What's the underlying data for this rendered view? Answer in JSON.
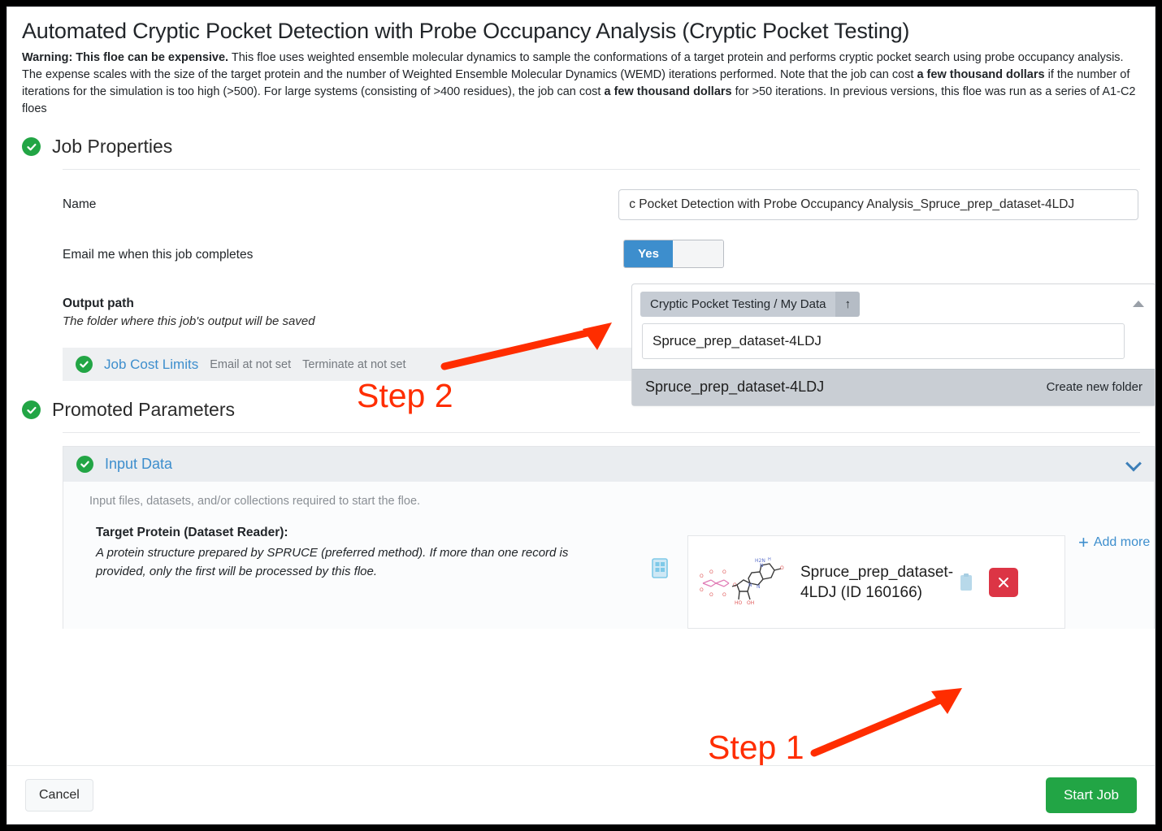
{
  "header": {
    "title": "Automated Cryptic Pocket Detection with Probe Occupancy Analysis (Cryptic Pocket Testing)",
    "warning_bold": "Warning: This floe can be expensive.",
    "desc_1": " This floe uses weighted ensemble molecular dynamics to sample the conformations of a target protein and performs cryptic pocket search using probe occupancy analysis. The expense scales with the size of the target protein and the number of Weighted Ensemble Molecular Dynamics (WEMD) iterations performed. Note that the job can cost ",
    "bold_1": "a few thousand dollars",
    "desc_2": " if the number of iterations for the simulation is too high (>500). For large systems (consisting of >400 residues), the job can cost ",
    "bold_2": "a few thousand dollars",
    "desc_3": " for >50 iterations. In previous versions, this floe was run as a series of A1-C2 floes"
  },
  "job_properties": {
    "section_title": "Job Properties",
    "name_label": "Name",
    "name_value": "c Pocket Detection with Probe Occupancy Analysis_Spruce_prep_dataset-4LDJ",
    "email_label": "Email me when this job completes",
    "toggle_on_label": "Yes",
    "output_path_label": "Output path",
    "output_path_sub": "The folder where this job's output will be saved"
  },
  "output_dropdown": {
    "breadcrumb": "Cryptic Pocket Testing / My Data",
    "up_icon": "arrow-up-icon",
    "search_value": "Spruce_prep_dataset-4LDJ",
    "option_name": "Spruce_prep_dataset-4LDJ",
    "create_new_folder": "Create new folder"
  },
  "job_cost_limits": {
    "title": "Job Cost Limits",
    "email_at": "Email at not set",
    "terminate_at": "Terminate at not set"
  },
  "promoted_parameters": {
    "section_title": "Promoted Parameters",
    "input_data": {
      "title": "Input Data",
      "subtitle": "Input files, datasets, and/or collections required to start the floe.",
      "param_title": "Target Protein (Dataset Reader):",
      "param_desc": "A protein structure prepared by SPRUCE (preferred method). If more than one record is provided, only the first will be processed by this floe.",
      "card_name": "Spruce_prep_dataset-4LDJ (ID 160166)",
      "add_more_label": "Add more",
      "remove_label": "×"
    }
  },
  "annotations": {
    "step1": "Step 1",
    "step2": "Step 2",
    "color": "#ff2d00"
  },
  "footer": {
    "cancel_label": "Cancel",
    "start_label": "Start Job"
  },
  "colors": {
    "accent_blue": "#3d8ecd",
    "success_green": "#22a545",
    "danger_red": "#dc3545",
    "annotation_red": "#ff2d00"
  }
}
